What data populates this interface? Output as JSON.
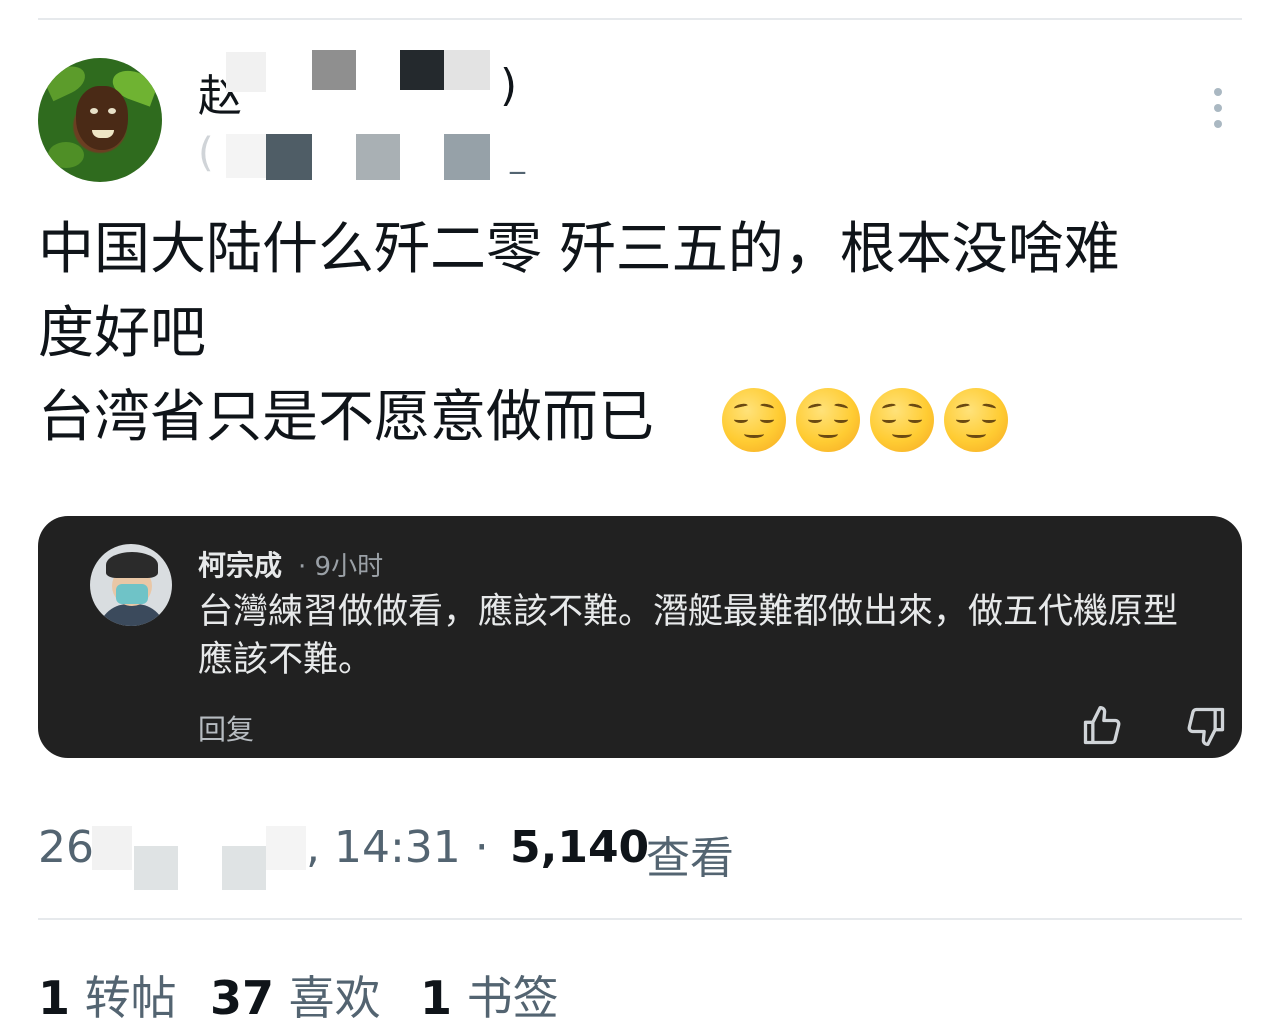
{
  "header": {
    "display_name_visible_start": "赵",
    "display_name_visible_end": ")",
    "handle_visible_start": "(",
    "handle_visible_end": "_"
  },
  "tweet": {
    "text": "中国大陆什么歼二零 歼三五的，根本没啥难\n度好吧\n台湾省只是不愿意做而已 ",
    "emojis": [
      "relieved-face-emoji",
      "relieved-face-emoji",
      "relieved-face-emoji",
      "relieved-face-emoji"
    ]
  },
  "quoted_comment": {
    "author": "柯宗成",
    "separator": "·",
    "time": "9小时",
    "text": "台灣練習做做看，應該不難。潛艇最難都做出來，做五代機原型應該不難。",
    "reply_label": "回复",
    "icons": [
      "thumbs-up-icon",
      "thumbs-down-icon"
    ]
  },
  "meta": {
    "date_visible_start": "26",
    "time": ", 14:31 ·",
    "views_count": "5,140",
    "views_label": "查看"
  },
  "stats": [
    {
      "count": "1",
      "label": "转帖"
    },
    {
      "count": "37",
      "label": "喜欢"
    },
    {
      "count": "1",
      "label": "书签"
    }
  ],
  "colors": {
    "card_background": "#212121",
    "text_primary": "#0f1419",
    "text_secondary": "#536471"
  }
}
